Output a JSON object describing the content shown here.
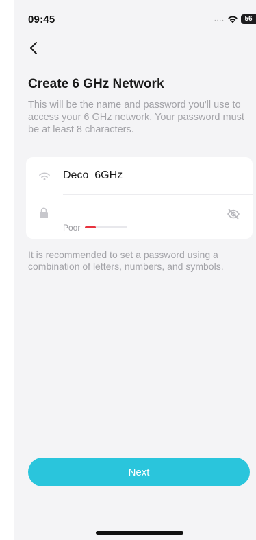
{
  "status_bar": {
    "time": "09:45",
    "signal": "....",
    "battery": "56"
  },
  "page": {
    "title": "Create 6 GHz Network",
    "description": "This will be the name and password you'll use to access your 6 GHz network. Your password must be at least 8 characters."
  },
  "network_form": {
    "ssid": "Deco_6GHz",
    "password_value": "",
    "strength_label": "Poor",
    "strength_level": 0.25,
    "strength_color": "#e8333e"
  },
  "hint": "It is recommended to set a password using a combination of letters, numbers, and symbols.",
  "actions": {
    "next_label": "Next"
  },
  "colors": {
    "accent": "#2ac5dc",
    "background": "#f4f4f6"
  },
  "icons": {
    "back": "chevron-left-icon",
    "wifi": "wifi-icon",
    "lock": "lock-icon",
    "visibility": "eye-slash-icon"
  }
}
